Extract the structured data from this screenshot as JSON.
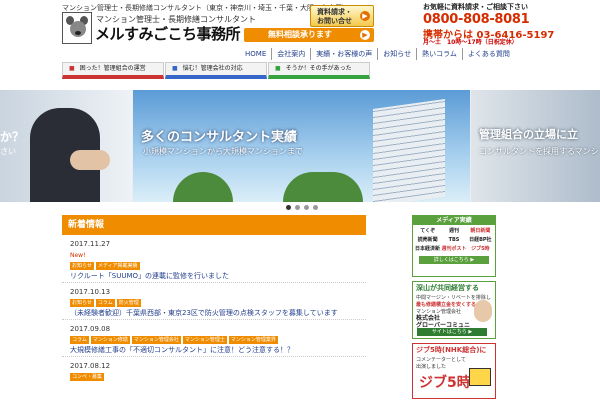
{
  "header": {
    "tagline": "マンション管理士・長期修繕コンサルタント（東京・神奈川・埼玉・千葉・大阪・名古屋）",
    "name_small": "マンション管理士・長期修繕コンサルタント",
    "name_big": "メルすみごこち事務所",
    "inquiry_btn": "資料請求・\nお問い合せ",
    "free_consult_btn": "無料相談承ります",
    "contact_line1": "お気軽に資料請求・ご相談下さい",
    "phone_free": "0800-808-8081",
    "phone_mobile": "携帯からは 03-6416-5197",
    "hours": "月〜土　10時〜17時（日祝定休）"
  },
  "nav": {
    "items": [
      "HOME",
      "会社案内",
      "実績・お客様の声",
      "お知らせ",
      "熱いコラム",
      "よくある質問"
    ]
  },
  "category_tabs": [
    {
      "mark": "■",
      "label": "困った！管理組合の運営"
    },
    {
      "mark": "■",
      "label": "悩む！管理会社の対応"
    },
    {
      "mark": "■",
      "label": "そうか！その手があった"
    }
  ],
  "slider": {
    "left_title": "か？",
    "left_sub": "さい",
    "main_title": "多くのコンサルタント実績",
    "main_sub": "小規模マンションから大規模マンションまで",
    "right_title": "管理組合の立場に立",
    "right_sub": "コンサルタントを採用するマンシ"
  },
  "news": {
    "heading": "新着情報",
    "items": [
      {
        "date": "2017.11.27",
        "new": "New!",
        "tags": [
          "お知らせ",
          "メディア掲載実績"
        ],
        "title": "リクルート「SUUMO」の連載に監修を行いました"
      },
      {
        "date": "2017.10.13",
        "new": "",
        "tags": [
          "お知らせ",
          "コラム",
          "防火管理"
        ],
        "title": "（未経験者歓迎）千葉県西部・東京23区で防火管理の点検スタッフを募集しています"
      },
      {
        "date": "2017.09.08",
        "new": "",
        "tags": [
          "コラム",
          "マンション修繕",
          "マンション管理会社",
          "マンション管理士",
          "マンション管理業界"
        ],
        "title": "大規模修繕工事の「不適切コンサルタント」に注意！どう注意する！？"
      },
      {
        "date": "2017.08.12",
        "new": "",
        "tags": [
          "コンペ・募集"
        ],
        "title": ""
      }
    ]
  },
  "sidebar": {
    "media_heading": "メディア実績",
    "media_logos": [
      "てくぞ",
      "週刊",
      "朝日新聞",
      "読売新聞",
      "TBS",
      "日経BP社",
      "日本経済新聞",
      "",
      "週刊ポスト",
      "ジブ5時",
      "",
      ""
    ],
    "media_btn": "詳しくはこちら ▶",
    "deep_title": "深山が共同経営する",
    "deep_l1": "中間マージン・リベートを排除し",
    "deep_l2": "最も修繕積立金を安くする",
    "deep_l3": "株式会社\nグローバーコミュニ",
    "deep_btn": "サイトはこちら ▶",
    "deep_tag": "マンション管理会社",
    "jib_title": "ジブ5時(NHK総合)に",
    "jib_sub": "コメンテーターとして",
    "jib_sub2": "出演しました",
    "jib_big": "ジブ5時"
  },
  "colors": {
    "accent_orange": "#f08c00",
    "phone_red": "#d62c00",
    "link_blue": "#24408e",
    "green": "#5aa03c"
  }
}
